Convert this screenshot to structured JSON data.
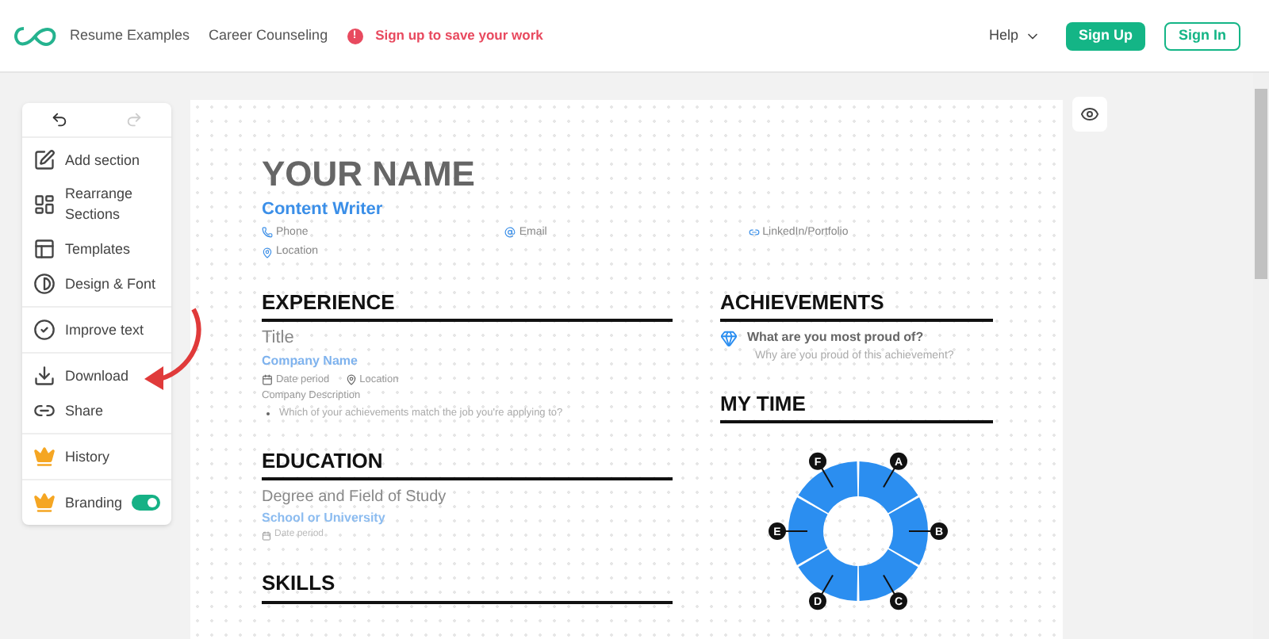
{
  "header": {
    "nav": [
      "Resume Examples",
      "Career Counseling"
    ],
    "alert_icon": "!",
    "alert": "Sign up to save your work",
    "help": "Help",
    "sign_up": "Sign Up",
    "sign_in": "Sign In"
  },
  "sidebar": {
    "groups": [
      [
        {
          "kind": "plain",
          "label": "Add section"
        },
        {
          "kind": "plain",
          "label": "Rearrange Sections"
        },
        {
          "kind": "plain",
          "label": "Templates"
        },
        {
          "kind": "plain",
          "label": "Design & Font"
        }
      ],
      [
        {
          "kind": "plain",
          "label": "Improve text"
        }
      ],
      [
        {
          "kind": "plain",
          "label": "Download"
        },
        {
          "kind": "plain",
          "label": "Share"
        }
      ],
      [
        {
          "kind": "premium",
          "label": "History"
        }
      ],
      [
        {
          "kind": "premium",
          "label": "Branding",
          "on": true
        }
      ]
    ]
  },
  "resume": {
    "name": "YOUR NAME",
    "role": "Content Writer",
    "contacts": [
      "Phone",
      "Email",
      "LinkedIn/Portfolio",
      "Location"
    ],
    "experience": {
      "heading": "EXPERIENCE",
      "title": "Title",
      "company": "Company Name",
      "date": "Date period",
      "location": "Location",
      "description": "Company Description",
      "bullet": "Which of your achievements match the job you're applying to?"
    },
    "education": {
      "heading": "EDUCATION",
      "degree": "Degree and Field of Study",
      "school": "School or University",
      "date": "Date period"
    },
    "skills": {
      "heading": "SKILLS"
    },
    "achievements": {
      "heading": "ACHIEVEMENTS",
      "title": "What are you most proud of?",
      "subtitle": "Why are you proud of this achievement?"
    },
    "my_time": {
      "heading": "MY TIME",
      "labels": [
        "A",
        "B",
        "C",
        "D",
        "E",
        "F"
      ]
    }
  }
}
